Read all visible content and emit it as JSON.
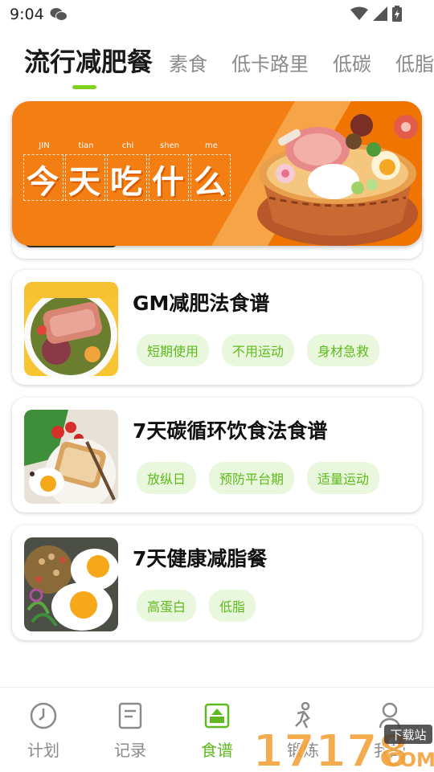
{
  "status_bar": {
    "time": "9:04"
  },
  "tabs": [
    {
      "label": "流行减肥餐",
      "active": true
    },
    {
      "label": "素食",
      "active": false
    },
    {
      "label": "低卡路里",
      "active": false
    },
    {
      "label": "低碳",
      "active": false
    },
    {
      "label": "低脂",
      "active": false
    }
  ],
  "banner": {
    "pinyin": [
      "JIN",
      "tian",
      "chi",
      "shen",
      "me"
    ],
    "characters": [
      "今",
      "天",
      "吃",
      "什",
      "么"
    ]
  },
  "recipes": [
    {
      "title": "GM减肥法食谱",
      "tags": [
        "短期使用",
        "不用运动",
        "身材急救"
      ]
    },
    {
      "title": "7天碳循环饮食法食谱",
      "tags": [
        "放纵日",
        "预防平台期",
        "适量运动"
      ]
    },
    {
      "title": "7天健康减脂餐",
      "tags": [
        "高蛋白",
        "低脂"
      ]
    }
  ],
  "bottom_nav": [
    {
      "label": "计划",
      "icon": "clock-icon",
      "active": false
    },
    {
      "label": "记录",
      "icon": "notebook-icon",
      "active": false
    },
    {
      "label": "食谱",
      "icon": "recipe-book-icon",
      "active": true
    },
    {
      "label": "锻炼",
      "icon": "exercise-icon",
      "active": false
    },
    {
      "label": "我的",
      "icon": "profile-icon",
      "active": false
    }
  ],
  "watermark": {
    "brand": "17178",
    "site": "COM",
    "badge": "下载站"
  },
  "colors": {
    "accent": "#7ed321",
    "tag_text": "#5fb91e",
    "tag_bg": "#e9f8dc",
    "banner": "#f37f14"
  }
}
